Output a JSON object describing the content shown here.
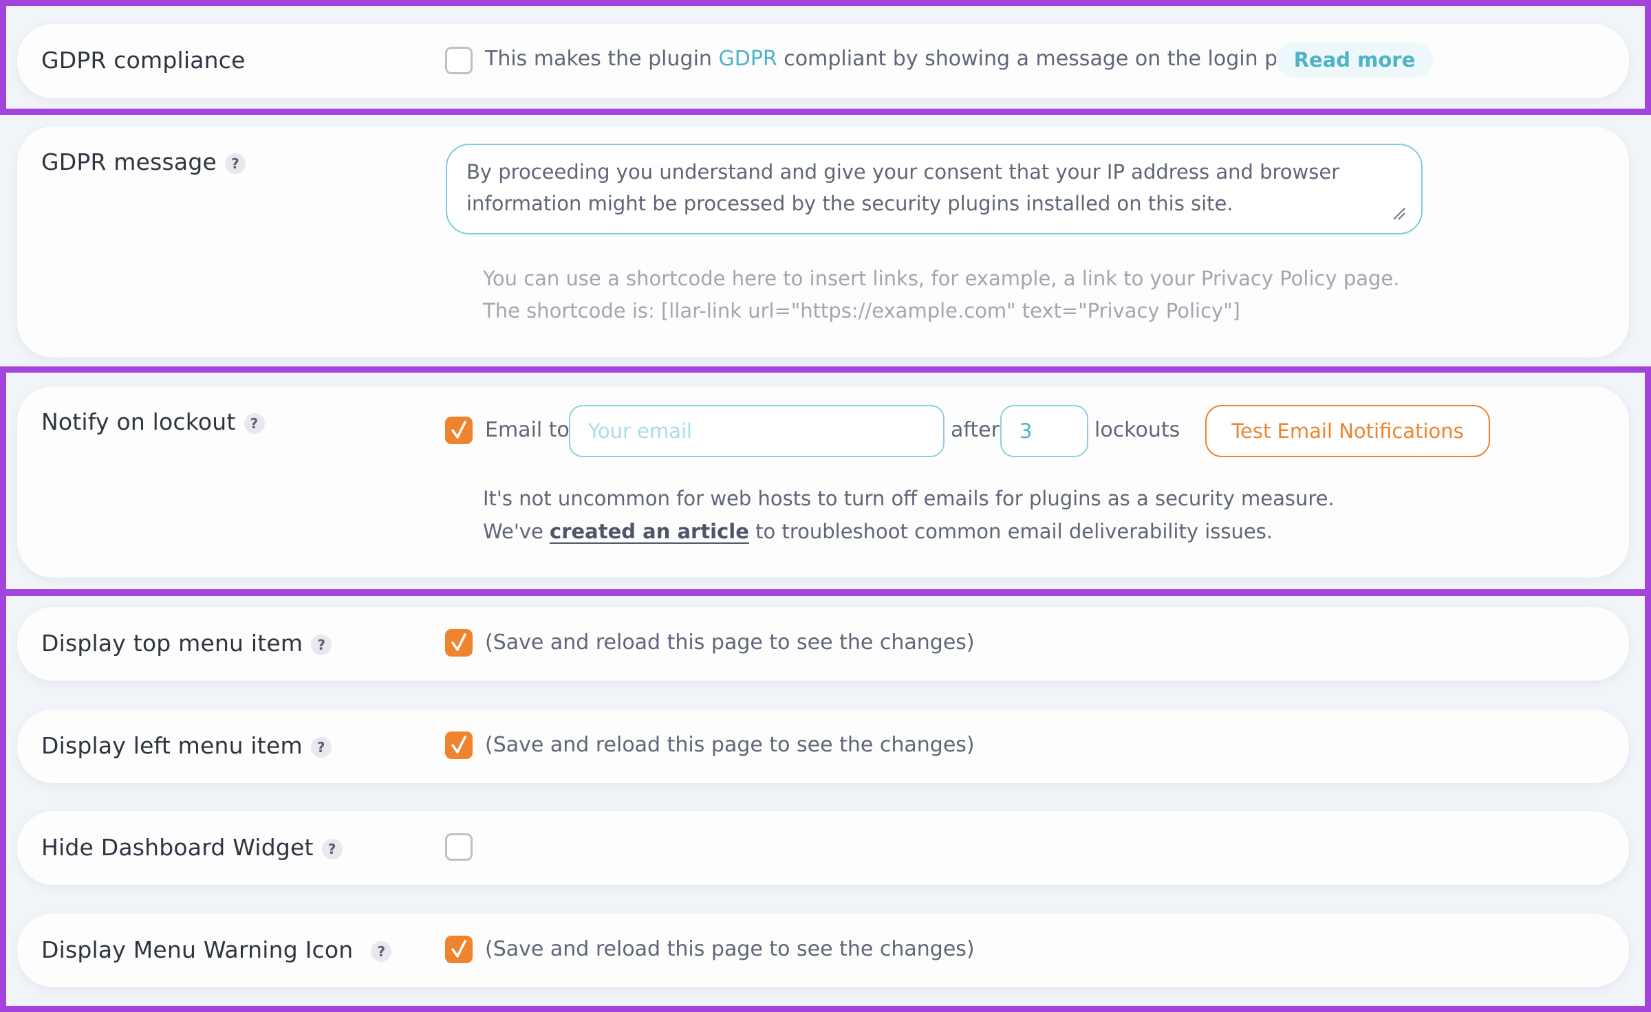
{
  "colors": {
    "accent_teal": "#4FB3C8",
    "accent_orange": "#F0832E",
    "highlight_frame": "#A444DF",
    "page_background": "#F1F4F8"
  },
  "gdpr_compliance": {
    "label": "GDPR compliance",
    "checked": false,
    "text_before": "This makes the plugin ",
    "link": "GDPR",
    "text_after": " compliant by showing a message on the login page.",
    "read_more": "Read more"
  },
  "gdpr_message": {
    "label": "GDPR message",
    "help": "?",
    "value": "By proceeding you understand and give your consent that your IP address and browser information might be processed by the security plugins installed on this site.",
    "hint_line1": "You can use a shortcode here to insert links, for example, a link to your Privacy Policy page.",
    "hint_line2": "The shortcode is: [llar-link url=\"https://example.com\" text=\"Privacy Policy\"]"
  },
  "notify_on_lockout": {
    "label": "Notify on lockout",
    "help": "?",
    "checked": true,
    "email_to_label": "Email to",
    "email_placeholder": "Your email",
    "after_label": "after",
    "lockouts_value": "3",
    "lockouts_label": "lockouts",
    "test_button": "Test Email Notifications",
    "note_line1": "It's not uncommon for web hosts to turn off emails for plugins as a security measure.",
    "note_line2_before": "We've ",
    "note_link": "created an article",
    "note_line2_after": " to troubleshoot common email deliverability issues."
  },
  "settings": [
    {
      "label": "Display top menu item",
      "help": "?",
      "checked": true,
      "text": "(Save and reload this page to see the changes)"
    },
    {
      "label": "Display left menu item",
      "help": "?",
      "checked": true,
      "text": "(Save and reload this page to see the changes)"
    },
    {
      "label": "Hide Dashboard Widget",
      "help": "?",
      "checked": false,
      "text": ""
    },
    {
      "label": "Display Menu Warning Icon",
      "help": "?",
      "checked": true,
      "text": "(Save and reload this page to see the changes)"
    }
  ]
}
